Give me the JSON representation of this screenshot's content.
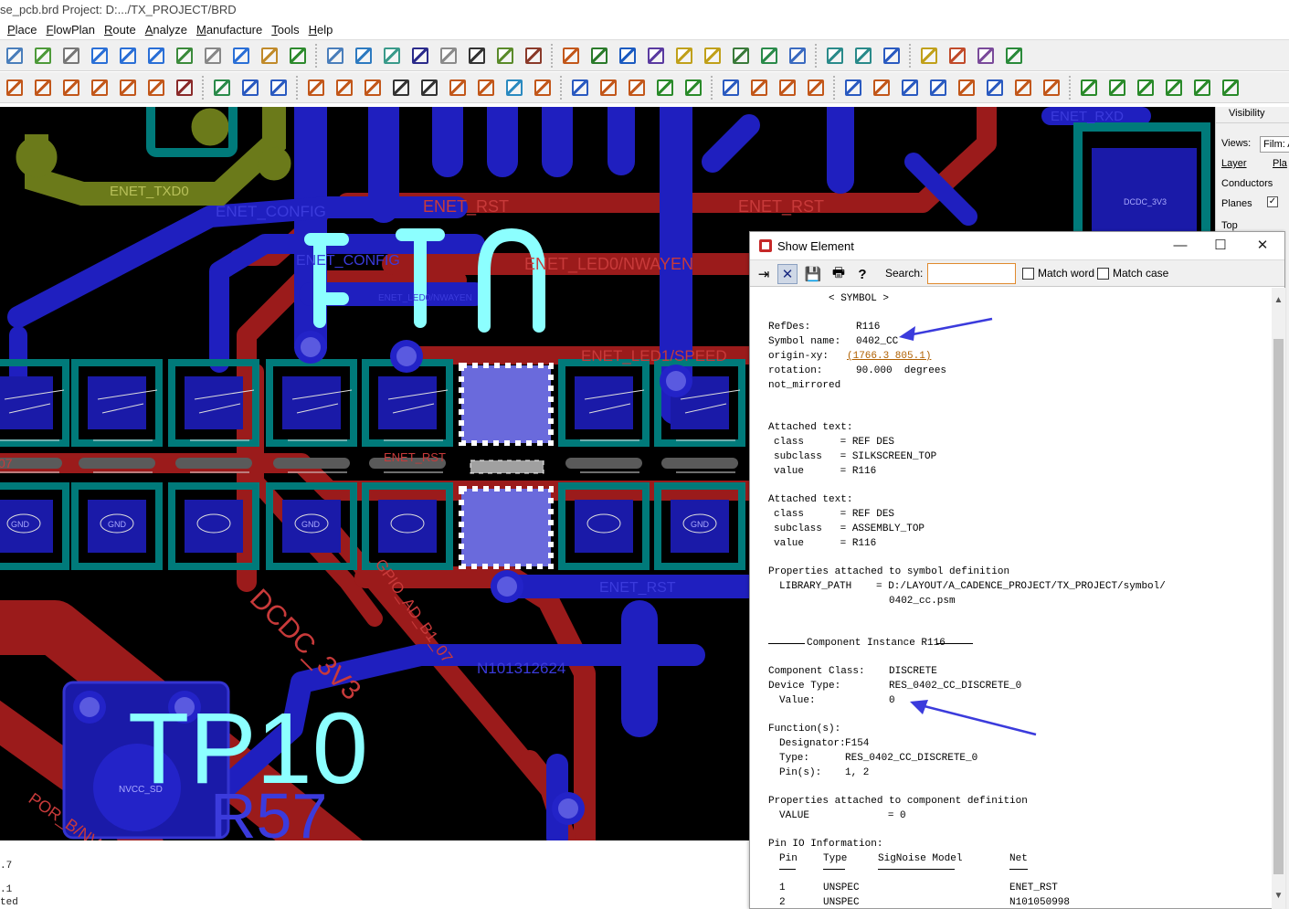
{
  "window": {
    "title": "se_pcb.brd  Project: D:.../TX_PROJECT/BRD"
  },
  "menu": [
    {
      "label": "Place",
      "ul": "P"
    },
    {
      "label": "FlowPlan",
      "ul": "F"
    },
    {
      "label": "Route",
      "ul": "R"
    },
    {
      "label": "Analyze",
      "ul": "A"
    },
    {
      "label": "Manufacture",
      "ul": "M"
    },
    {
      "label": "Tools",
      "ul": "T"
    },
    {
      "label": "Help",
      "ul": "H"
    }
  ],
  "canvas": {
    "net_labels": [
      "ENET_TXD0",
      "ENET_CONFIG",
      "ENET_RST",
      "ENET_RST",
      "ENET_CONFIG",
      "ENET_LED0/NWAYEN",
      "ENET_LED0/NWAYEN",
      "ENET_LED1/SPEED",
      "ENET_RST",
      "ENET_RST",
      "DCDC_3V3",
      "DCDC_3V3_DCDC",
      "GPIO_AD_B1_07",
      "N101312624",
      "NVCC_SD",
      "NVCC_SD",
      "POR_B/NVCC_SD",
      "ENET_RXD",
      "GND",
      "GND",
      "GND",
      "GND",
      "07"
    ],
    "silk_text": [
      "TP10",
      "R57"
    ],
    "colors": {
      "background": "#000000",
      "top_etch": "#9b1b1b",
      "bottom_etch": "#1f1fbf",
      "pads": "#008080",
      "vias_olive": "#6b7a1a",
      "silkscreen": "#8cffff"
    }
  },
  "console": {
    "lines": [
      ".7",
      ".1",
      "ted"
    ]
  },
  "visibility": {
    "header": "Visibility",
    "views_label": "Views:",
    "views_value": "Film: A",
    "layer_label": "Layer",
    "plan_label": "Pla",
    "conductors_label": "Conductors",
    "planes_label": "Planes",
    "planes_checked": "✓",
    "top_label": "Top"
  },
  "dialog": {
    "title": "Show Element",
    "search_label": "Search:",
    "search_value": "",
    "match_word_label": "Match word",
    "match_case_label": "Match case",
    "symbol_header": "< SYMBOL >",
    "refdes_label": "RefDes:",
    "refdes_value": "R116",
    "symbol_name_label": "Symbol name:",
    "symbol_name_value": "0402_CC",
    "origin_label": "origin-xy:",
    "origin_value": "(1766.3 805.1)",
    "rotation_label": "rotation:",
    "rotation_value": "90.000  degrees",
    "mirror_value": "not_mirrored",
    "attached1_header": "Attached text:",
    "attached1_class": "class      = REF DES",
    "attached1_subclass": "subclass   = SILKSCREEN_TOP",
    "attached1_value": "value      = R116",
    "attached2_header": "Attached text:",
    "attached2_class": "class      = REF DES",
    "attached2_subclass": "subclass   = ASSEMBLY_TOP",
    "attached2_value": "value      = R116",
    "props_symbol_header": "Properties attached to symbol definition",
    "library_path_label": "LIBRARY_PATH",
    "library_path_value": "= D:/LAYOUT/A_CADENCE_PROJECT/TX_PROJECT/symbol/",
    "library_path_value2": "0402_cc.psm",
    "component_instance_header": "Component Instance R116",
    "component_class_label": "Component Class:",
    "component_class_value": "DISCRETE",
    "device_type_label": "Device Type:",
    "device_type_value": "RES_0402_CC_DISCRETE_0",
    "value_label": "Value:",
    "value_value": "0",
    "functions_header": "Function(s):",
    "designator_label": "Designator:",
    "designator_value": "F154",
    "type_label": "Type:",
    "type_value": "RES_0402_CC_DISCRETE_0",
    "pins_label": "Pin(s):",
    "pins_value": "1, 2",
    "props_component_header": "Properties attached to component definition",
    "props_component_value": "VALUE             = 0",
    "pin_io_header": "Pin IO Information:",
    "pin_table": {
      "headers": [
        "Pin",
        "Type",
        "SigNoise Model",
        "Net"
      ],
      "rows": [
        [
          "1",
          "UNSPEC",
          "",
          "ENET_RST"
        ],
        [
          "2",
          "UNSPEC",
          "",
          "N101050998"
        ]
      ]
    }
  }
}
